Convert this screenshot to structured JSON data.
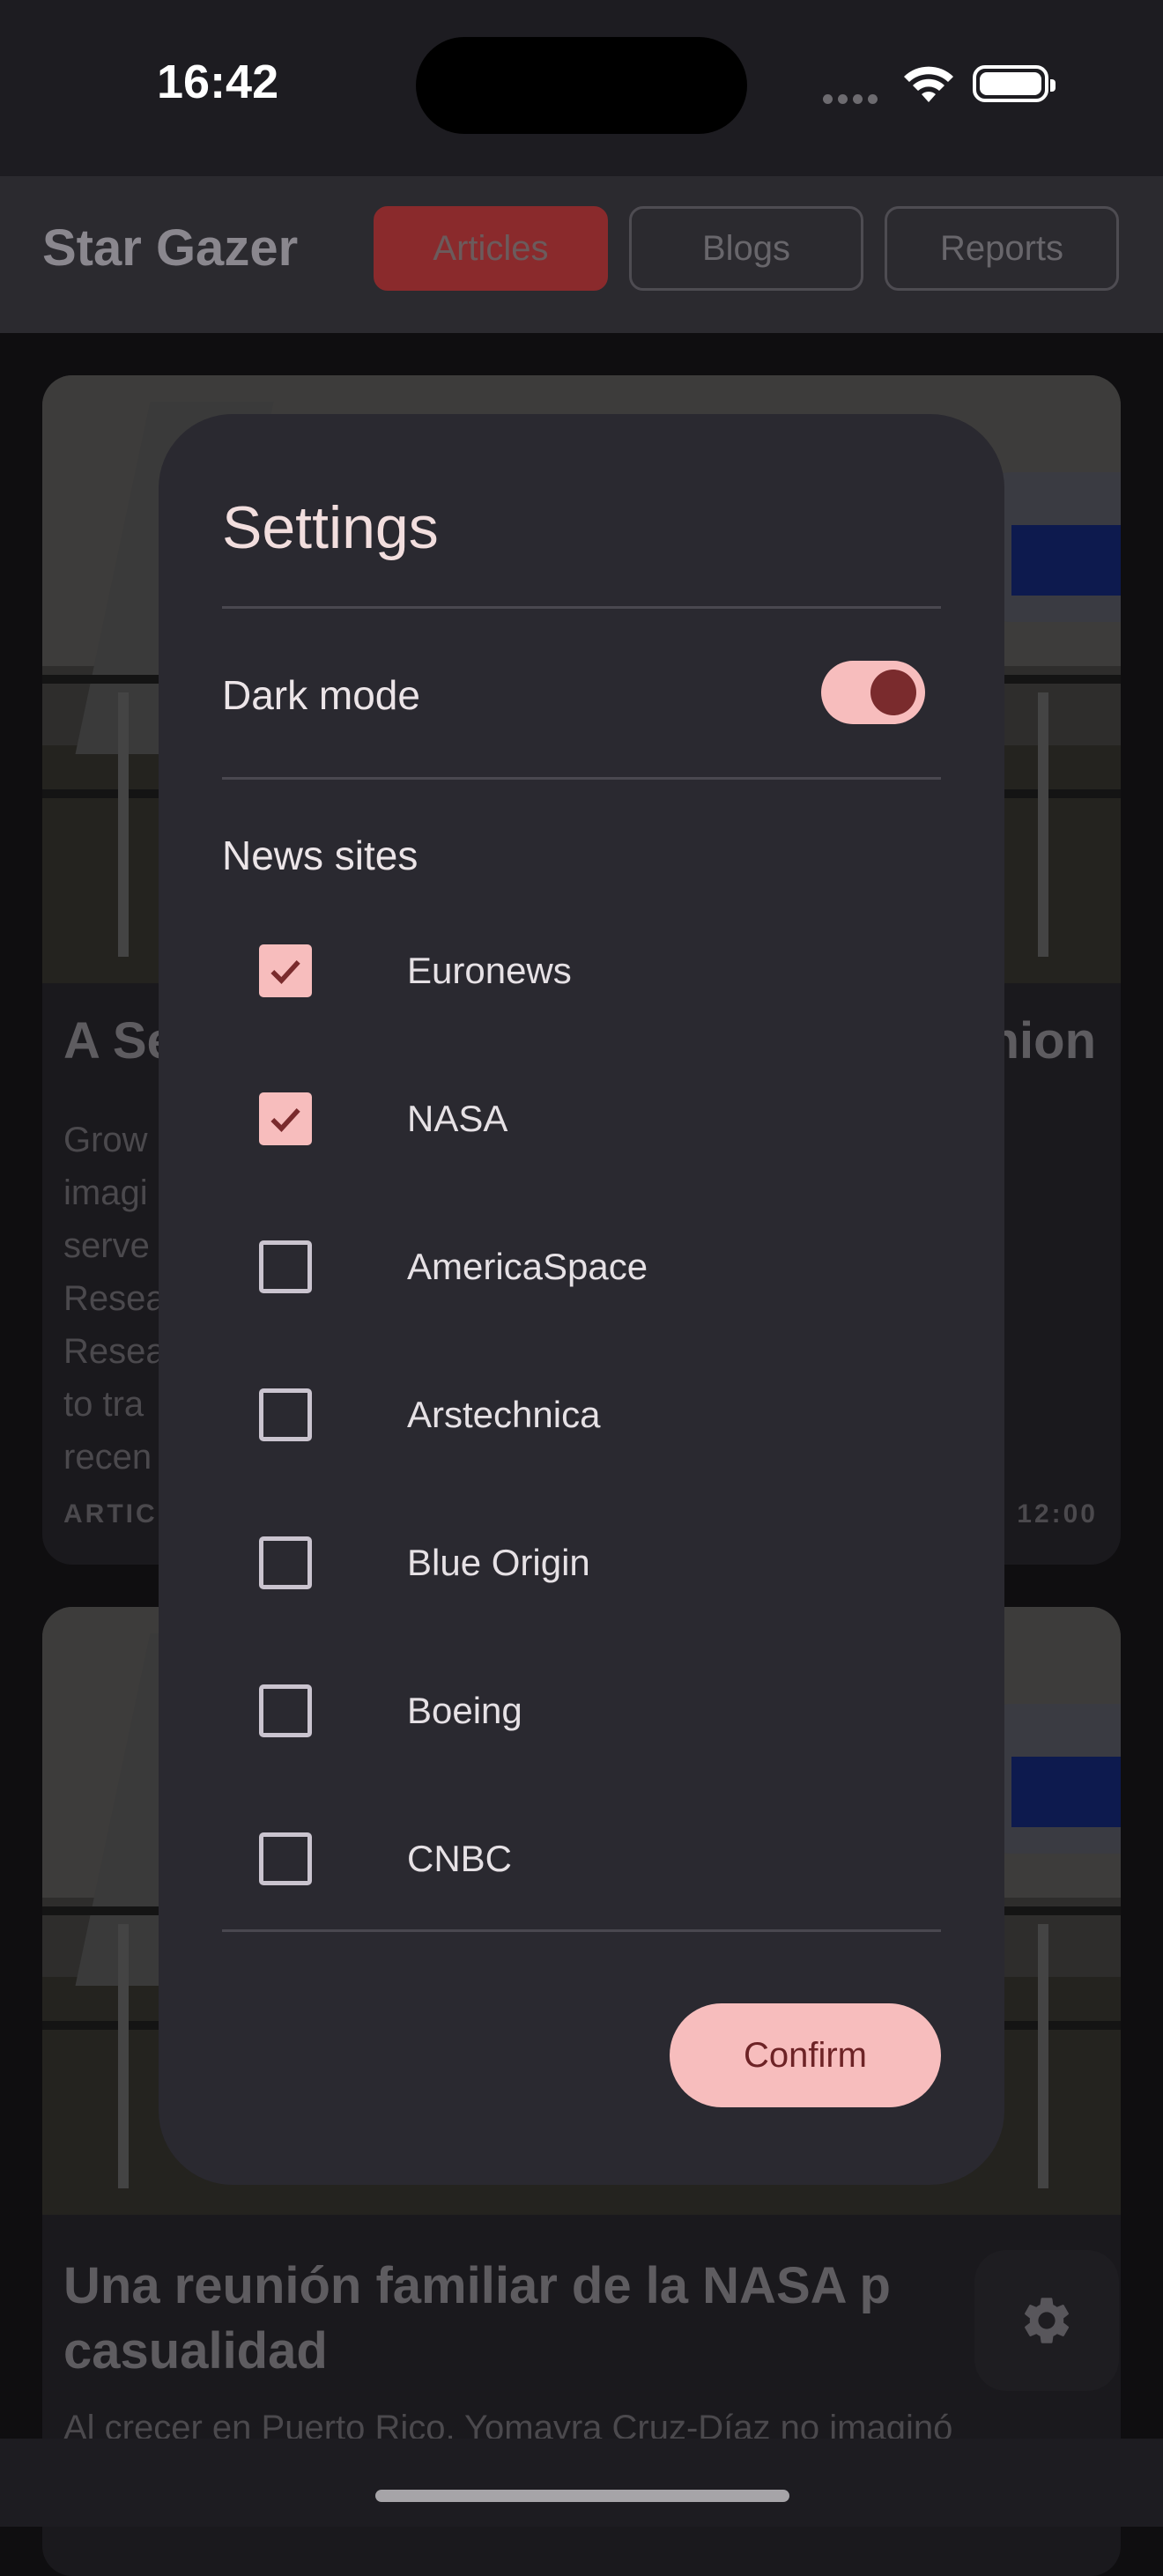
{
  "status_bar": {
    "time": "16:42"
  },
  "app_bar": {
    "title": "Star Gazer",
    "tabs": [
      {
        "label": "Articles",
        "selected": true
      },
      {
        "label": "Blogs",
        "selected": false
      },
      {
        "label": "Reports",
        "selected": false
      }
    ]
  },
  "cards": [
    {
      "title_left": "A Se",
      "title_right": "nion",
      "body": "Grow imagi serve Resea Resea to tra recen",
      "meta_left": "ARTIC",
      "meta_right": "12:00"
    },
    {
      "title": "Una reunión familiar de la NASA p casualidad",
      "body": "Al crecer en Puerto Rico, Yomayra Cruz-Díaz no imaginó"
    }
  ],
  "dialog": {
    "title": "Settings",
    "dark_mode_label": "Dark mode",
    "dark_mode_on": true,
    "news_sites_label": "News sites",
    "sites": [
      {
        "label": "Euronews",
        "checked": true
      },
      {
        "label": "NASA",
        "checked": true
      },
      {
        "label": "AmericaSpace",
        "checked": false
      },
      {
        "label": "Arstechnica",
        "checked": false
      },
      {
        "label": "Blue Origin",
        "checked": false
      },
      {
        "label": "Boeing",
        "checked": false
      },
      {
        "label": "CNBC",
        "checked": false
      }
    ],
    "confirm_label": "Confirm"
  },
  "fab": {
    "icon": "gear-icon"
  },
  "colors": {
    "accent": "#f7bdbd",
    "accent_dark": "#7a2b2d",
    "dialog_bg": "#2a2930"
  }
}
